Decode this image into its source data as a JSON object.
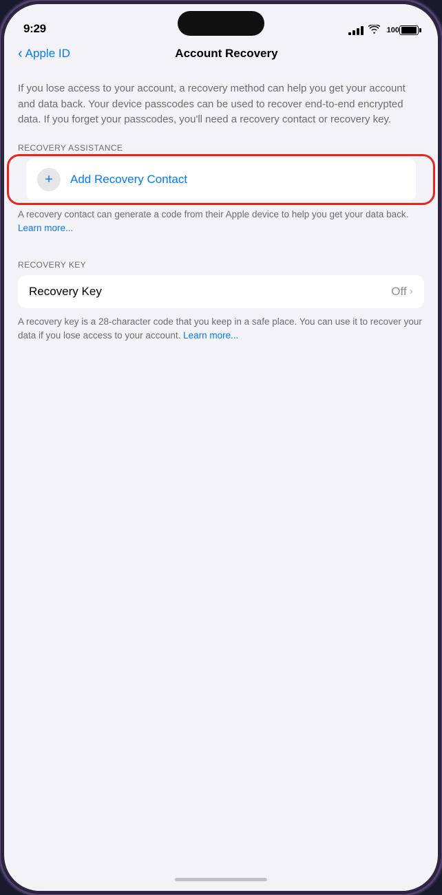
{
  "status_bar": {
    "time": "9:29",
    "battery_label": "100",
    "signal_alt": "signal"
  },
  "navigation": {
    "back_label": "Apple ID",
    "title": "Account Recovery"
  },
  "intro": {
    "text": "If you lose access to your account, a recovery method can help you get your account and data back. Your device passcodes can be used to recover end-to-end encrypted data. If you forget your passcodes, you'll need a recovery contact or recovery key."
  },
  "recovery_assistance": {
    "section_header": "RECOVERY ASSISTANCE",
    "add_contact_label": "Add Recovery Contact",
    "plus_icon": "+",
    "footer_text": "A recovery contact can generate a code from their Apple device to help you get your data back. ",
    "learn_more": "Learn more..."
  },
  "recovery_key": {
    "section_header": "RECOVERY KEY",
    "label": "Recovery Key",
    "value": "Off",
    "footer_text": "A recovery key is a 28-character code that you keep in a safe place. You can use it to recover your data if you lose access to your account. ",
    "learn_more": "Learn more..."
  }
}
